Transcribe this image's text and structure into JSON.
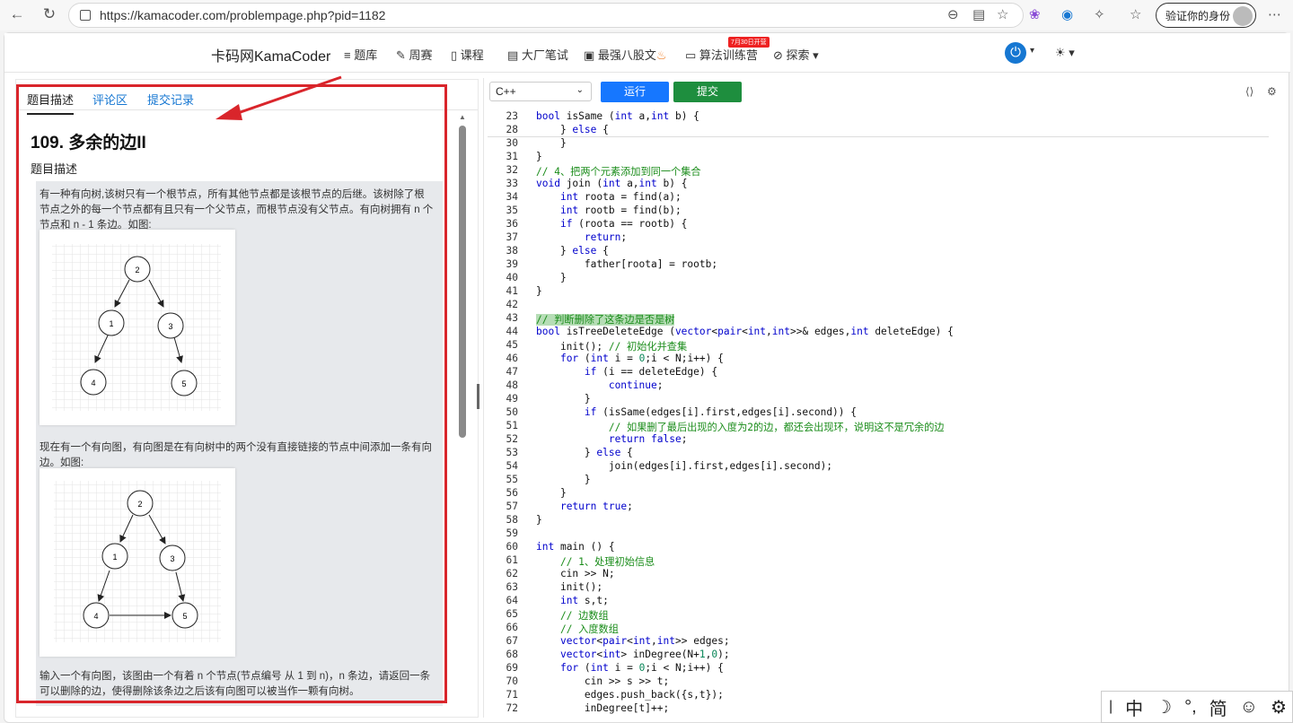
{
  "browser": {
    "url": "https://kamacoder.com/problempage.php?pid=1182",
    "profile": "验证你的身份",
    "icons": [
      "back-icon",
      "reload-icon",
      "lock-icon",
      "zoom-icon",
      "reader-icon",
      "favorite-icon",
      "extension-icon",
      "collections-icon",
      "profile-icon",
      "more-icon"
    ]
  },
  "site": {
    "brand": "卡码网KamaCoder",
    "nav": [
      "题库",
      "周赛",
      "课程",
      "大厂笔试",
      "最强八股文",
      "算法训练营",
      "探索"
    ],
    "badge": "7月30日开营"
  },
  "tabs": [
    "题目描述",
    "评论区",
    "提交记录"
  ],
  "problem": {
    "title": "109. 多余的边II",
    "section": "题目描述",
    "p1": "有一种有向树,该树只有一个根节点，所有其他节点都是该根节点的后继。该树除了根节点之外的每一个节点都有且只有一个父节点，而根节点没有父节点。有向树拥有 n 个节点和 n - 1 条边。如图:",
    "p2": "现在有一个有向图，有向图是在有向树中的两个没有直接链接的节点中间添加一条有向边。如图:",
    "p3": "输入一个有向图，该图由一个有着 n 个节点(节点编号 从 1 到 n)，n 条边，请返回一条可以删除的边，使得删除该条边之后该有向图可以被当作一颗有向树。",
    "fig_nodes": [
      "2",
      "1",
      "3",
      "4",
      "5"
    ]
  },
  "editor": {
    "language": "C++",
    "run": "运行",
    "submit": "提交",
    "colors": {
      "run": "#1677ff",
      "submit": "#1e8e3e"
    },
    "lines": [
      [
        "23",
        "bool isSame (int a,int b) {"
      ],
      [
        "28",
        "    } else {"
      ],
      [
        "30",
        "    }"
      ],
      [
        "31",
        "}"
      ],
      [
        "32",
        "// 4、把两个元素添加到同一个集合"
      ],
      [
        "33",
        "void join (int a,int b) {"
      ],
      [
        "34",
        "    int roota = find(a);"
      ],
      [
        "35",
        "    int rootb = find(b);"
      ],
      [
        "36",
        "    if (roota == rootb) {"
      ],
      [
        "37",
        "        return;"
      ],
      [
        "38",
        "    } else {"
      ],
      [
        "39",
        "        father[roota] = rootb;"
      ],
      [
        "40",
        "    }"
      ],
      [
        "41",
        "}"
      ],
      [
        "42",
        ""
      ],
      [
        "43",
        "// 判断删除了这条边是否是树"
      ],
      [
        "44",
        "bool isTreeDeleteEdge (vector<pair<int,int>>& edges,int deleteEdge) {"
      ],
      [
        "45",
        "    init(); // 初始化并查集"
      ],
      [
        "46",
        "    for (int i = 0;i < N;i++) {"
      ],
      [
        "47",
        "        if (i == deleteEdge) {"
      ],
      [
        "48",
        "            continue;"
      ],
      [
        "49",
        "        }"
      ],
      [
        "50",
        "        if (isSame(edges[i].first,edges[i].second)) {"
      ],
      [
        "51",
        "            // 如果删了最后出现的入度为2的边，都还会出现环，说明这不是冗余的边"
      ],
      [
        "52",
        "            return false;"
      ],
      [
        "53",
        "        } else {"
      ],
      [
        "54",
        "            join(edges[i].first,edges[i].second);"
      ],
      [
        "55",
        "        }"
      ],
      [
        "56",
        "    }"
      ],
      [
        "57",
        "    return true;"
      ],
      [
        "58",
        "}"
      ],
      [
        "59",
        ""
      ],
      [
        "60",
        "int main () {"
      ],
      [
        "61",
        "    // 1、处理初始信息"
      ],
      [
        "62",
        "    cin >> N;"
      ],
      [
        "63",
        "    init();"
      ],
      [
        "64",
        "    int s,t;"
      ],
      [
        "65",
        "    // 边数组"
      ],
      [
        "66",
        "    // 入度数组"
      ],
      [
        "67",
        "    vector<pair<int,int>> edges;"
      ],
      [
        "68",
        "    vector<int> inDegree(N+1,0);"
      ],
      [
        "69",
        "    for (int i = 0;i < N;i++) {"
      ],
      [
        "70",
        "        cin >> s >> t;"
      ],
      [
        "71",
        "        edges.push_back({s,t});"
      ],
      [
        "72",
        "        inDegree[t]++;"
      ]
    ]
  },
  "ime": [
    "中",
    "☽",
    "°,",
    "简",
    "☺",
    "⚙"
  ]
}
